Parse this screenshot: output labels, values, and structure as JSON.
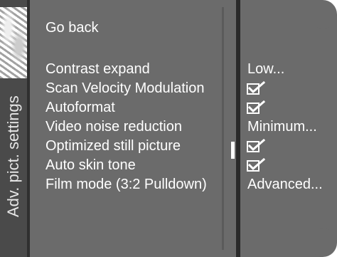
{
  "menu": {
    "side_tab_label": "Adv. pict. settings",
    "go_back": "Go back",
    "items": [
      {
        "label": "Contrast expand",
        "value": "Low...",
        "type": "text"
      },
      {
        "label": "Scan Velocity Modulation",
        "value": "",
        "type": "checkbox",
        "checked": true,
        "icon": "checkbox-checked-icon"
      },
      {
        "label": "Autoformat",
        "value": "",
        "type": "checkbox",
        "checked": true,
        "icon": "checkbox-checked-icon"
      },
      {
        "label": "Video noise reduction",
        "value": "Minimum...",
        "type": "text"
      },
      {
        "label": "Optimized still picture",
        "value": "",
        "type": "checkbox",
        "checked": true,
        "icon": "checkbox-checked-icon",
        "selected": true
      },
      {
        "label": "Auto skin tone",
        "value": "",
        "type": "checkbox",
        "checked": true,
        "icon": "checkbox-checked-icon"
      },
      {
        "label": "Film mode (3:2 Pulldown)",
        "value": "Advanced...",
        "type": "text"
      }
    ]
  },
  "colors": {
    "panel": "#6b6b6b",
    "side_tab": "#4a4a4a",
    "text": "#ffffff",
    "separator": "#2a2a2a"
  }
}
